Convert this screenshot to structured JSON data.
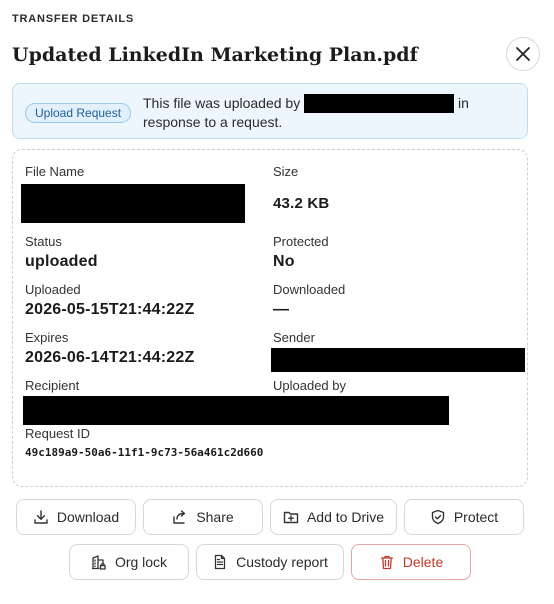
{
  "dialog": {
    "eyebrow": "TRANSFER DETAILS",
    "title": "Updated LinkedIn Marketing Plan.pdf"
  },
  "banner": {
    "badge": "Upload Request",
    "text_before": "This file was uploaded by",
    "text_after": "in response to a request."
  },
  "details": {
    "file_name_label": "File Name",
    "size_label": "Size",
    "size_value": "43.2 KB",
    "status_label": "Status",
    "status_value": "uploaded",
    "protected_label": "Protected",
    "protected_value": "No",
    "uploaded_label": "Uploaded",
    "uploaded_value": "2026-05-15T21:44:22Z",
    "downloaded_label": "Downloaded",
    "downloaded_value": "—",
    "expires_label": "Expires",
    "expires_value": "2026-06-14T21:44:22Z",
    "sender_label": "Sender",
    "recipient_label": "Recipient",
    "uploaded_by_label": "Uploaded by",
    "request_id_label": "Request ID",
    "request_id_value": "49c189a9-50a6-11f1-9c73-56a461c2d660"
  },
  "actions": {
    "download": "Download",
    "share": "Share",
    "add_to_drive": "Add to Drive",
    "protect": "Protect",
    "org_lock": "Org lock",
    "custody_report": "Custody report",
    "delete": "Delete"
  },
  "colors": {
    "banner_bg": "#eef6fd",
    "badge_text": "#1f5f95",
    "danger": "#c0392b"
  }
}
